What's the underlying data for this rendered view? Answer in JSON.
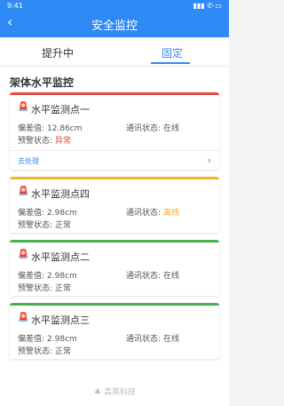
{
  "status_bar": {
    "time": "9:41",
    "signal_icons": "▮▮▮ ✆ ▭"
  },
  "header": {
    "title": "安全监控"
  },
  "tabs": [
    {
      "label": "提升中",
      "active": false
    },
    {
      "label": "固定",
      "active": true
    }
  ],
  "section": {
    "title": "架体水平监控"
  },
  "cards": [
    {
      "name": "水平监测点一",
      "status_color": "#e84a4a",
      "deviation_label": "偏差值:",
      "deviation_value": "12.86cm",
      "comm_label": "通讯状态:",
      "comm_value": "在线",
      "alarm_label": "预警状态:",
      "alarm_value": "异常",
      "alarm_color": "#e84a4a",
      "action_label": "去处理"
    },
    {
      "name": "水平监测点四",
      "status_color": "#f2b530",
      "deviation_label": "偏差值:",
      "deviation_value": "2.98cm",
      "comm_label": "通讯状态:",
      "comm_value": "离线",
      "comm_color": "#f2b530",
      "alarm_label": "预警状态:",
      "alarm_value": "正常"
    },
    {
      "name": "水平监测点二",
      "status_color": "#4caf50",
      "deviation_label": "偏差值:",
      "deviation_value": "2.98cm",
      "comm_label": "通讯状态:",
      "comm_value": "在线",
      "alarm_label": "预警状态:",
      "alarm_value": "正常"
    },
    {
      "name": "水平监测点三",
      "status_color": "#4caf50",
      "deviation_label": "偏差值:",
      "deviation_value": "2.98cm",
      "comm_label": "通讯状态:",
      "comm_value": "在线",
      "alarm_label": "预警状态:",
      "alarm_value": "正常"
    }
  ],
  "footer": {
    "logo_text": "高英科技"
  }
}
